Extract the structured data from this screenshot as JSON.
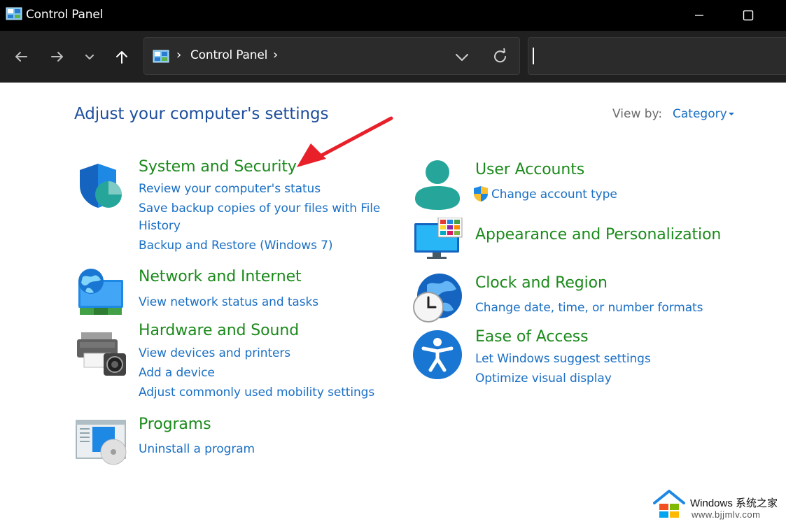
{
  "window": {
    "title": "Control Panel"
  },
  "address_bar": {
    "crumbs": [
      "Control Panel"
    ],
    "separator": "›"
  },
  "search": {
    "value": "",
    "placeholder": ""
  },
  "page": {
    "heading": "Adjust your computer's settings",
    "view_by_label": "View by:",
    "view_by_value": "Category"
  },
  "categories": {
    "system_security": {
      "title": "System and Security",
      "links": [
        "Review your computer's status",
        "Save backup copies of your files with File",
        "History",
        "Backup and Restore (Windows 7)"
      ]
    },
    "network": {
      "title": "Network and Internet",
      "links": [
        "View network status and tasks"
      ]
    },
    "hardware": {
      "title": "Hardware and Sound",
      "links": [
        "View devices and printers",
        "Add a device",
        "Adjust commonly used mobility settings"
      ]
    },
    "programs": {
      "title": "Programs",
      "links": [
        "Uninstall a program"
      ]
    },
    "user_accounts": {
      "title": "User Accounts",
      "links": [
        "Change account type"
      ]
    },
    "appearance": {
      "title": "Appearance and Personalization",
      "links": []
    },
    "clock": {
      "title": "Clock and Region",
      "links": [
        "Change date, time, or number formats"
      ]
    },
    "ease": {
      "title": "Ease of Access",
      "links": [
        "Let Windows suggest settings",
        "Optimize visual display"
      ]
    }
  },
  "watermark": {
    "brand": "Windows 系统之家",
    "url": "www.bjjmlv.com"
  },
  "colors": {
    "title_bar": "#000000",
    "nav_bar": "#202020",
    "category_title": "#1b8a1b",
    "link": "#1a6fc4",
    "heading": "#1e4e9c",
    "annotation_arrow": "#e8202a"
  },
  "icons": [
    "control-panel-icon",
    "minimize-icon",
    "maximize-icon",
    "back-arrow-icon",
    "forward-arrow-icon",
    "recent-locations-chevron-icon",
    "up-arrow-icon",
    "address-dropdown-icon",
    "refresh-icon",
    "shield-icon",
    "user-icon",
    "uac-shield-icon",
    "monitor-icon",
    "globe-network-icon",
    "globe-clock-icon",
    "printer-icon",
    "ease-of-access-icon",
    "programs-icon",
    "annotation-arrow",
    "windows-logo-icon"
  ]
}
